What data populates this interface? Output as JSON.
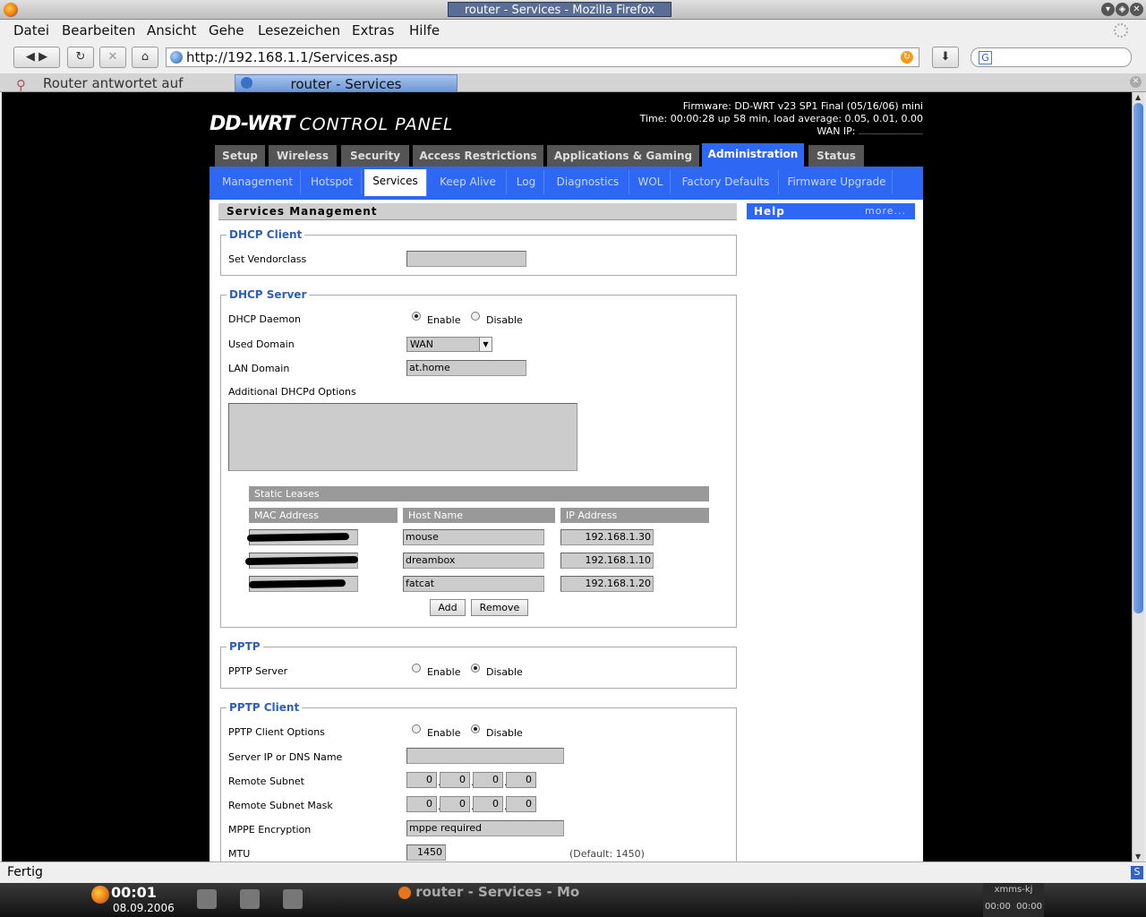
{
  "window": {
    "title": "router - Services - Mozilla Firefox"
  },
  "menu": [
    "Datei",
    "Bearbeiten",
    "Ansicht",
    "Gehe",
    "Lesezeichen",
    "Extras",
    "Hilfe"
  ],
  "url": "http://192.168.1.1/Services.asp",
  "search_icon_letter": "G",
  "tabs": {
    "inactive": "Router antwortet auf Freeb…",
    "active": "router - Services"
  },
  "header": {
    "logo": "DD-WRT",
    "logo_sub": "CONTROL PANEL",
    "firmware": "Firmware: DD-WRT v23 SP1 Final (05/16/06) mini",
    "time": "Time: 00:00:28 up 58 min, load average: 0.05, 0.01, 0.00",
    "wan_ip_label": "WAN IP:"
  },
  "main_tabs": [
    "Setup",
    "Wireless",
    "Security",
    "Access Restrictions",
    "Applications & Gaming",
    "Administration",
    "Status"
  ],
  "sub_tabs": [
    "Management",
    "Hotspot",
    "Services",
    "Keep Alive",
    "Log",
    "Diagnostics",
    "WOL",
    "Factory Defaults",
    "Firmware Upgrade"
  ],
  "section_title": "Services Management",
  "help": {
    "title": "Help",
    "more": "more..."
  },
  "dhcp_client": {
    "legend": "DHCP Client",
    "vendorclass_label": "Set Vendorclass",
    "vendorclass_value": ""
  },
  "dhcp_server": {
    "legend": "DHCP Server",
    "daemon_label": "DHCP Daemon",
    "enable": "Enable",
    "disable": "Disable",
    "used_domain_label": "Used Domain",
    "used_domain_value": "WAN",
    "lan_domain_label": "LAN Domain",
    "lan_domain_value": "at.home",
    "options_label": "Additional DHCPd Options",
    "static_leases_title": "Static Leases",
    "columns": [
      "MAC Address",
      "Host Name",
      "IP Address"
    ],
    "leases": [
      {
        "host": "mouse",
        "ip": "192.168.1.30"
      },
      {
        "host": "dreambox",
        "ip": "192.168.1.10"
      },
      {
        "host": "fatcat",
        "ip": "192.168.1.20"
      }
    ],
    "add_label": "Add",
    "remove_label": "Remove"
  },
  "pptp": {
    "legend": "PPTP",
    "server_label": "PPTP Server",
    "enable": "Enable",
    "disable": "Disable"
  },
  "pptp_client": {
    "legend": "PPTP Client",
    "options_label": "PPTP Client Options",
    "enable": "Enable",
    "disable": "Disable",
    "server_label": "Server IP or DNS Name",
    "subnet_label": "Remote Subnet",
    "subnet_values": [
      "0",
      "0",
      "0",
      "0"
    ],
    "mask_label": "Remote Subnet Mask",
    "mask_values": [
      "0",
      "0",
      "0",
      "0"
    ],
    "mppe_label": "MPPE Encryption",
    "mppe_value": "mppe required",
    "mtu_label": "MTU",
    "mtu_value": "1450",
    "mtu_default": "(Default: 1450)"
  },
  "status": "Fertig",
  "taskbar": {
    "clock": "00:01",
    "date": "08.09.2006",
    "task": "router - Services - Mo",
    "xmms": "xmms-kj",
    "xmms_time_a": "00:00",
    "xmms_time_b": "00:00"
  }
}
